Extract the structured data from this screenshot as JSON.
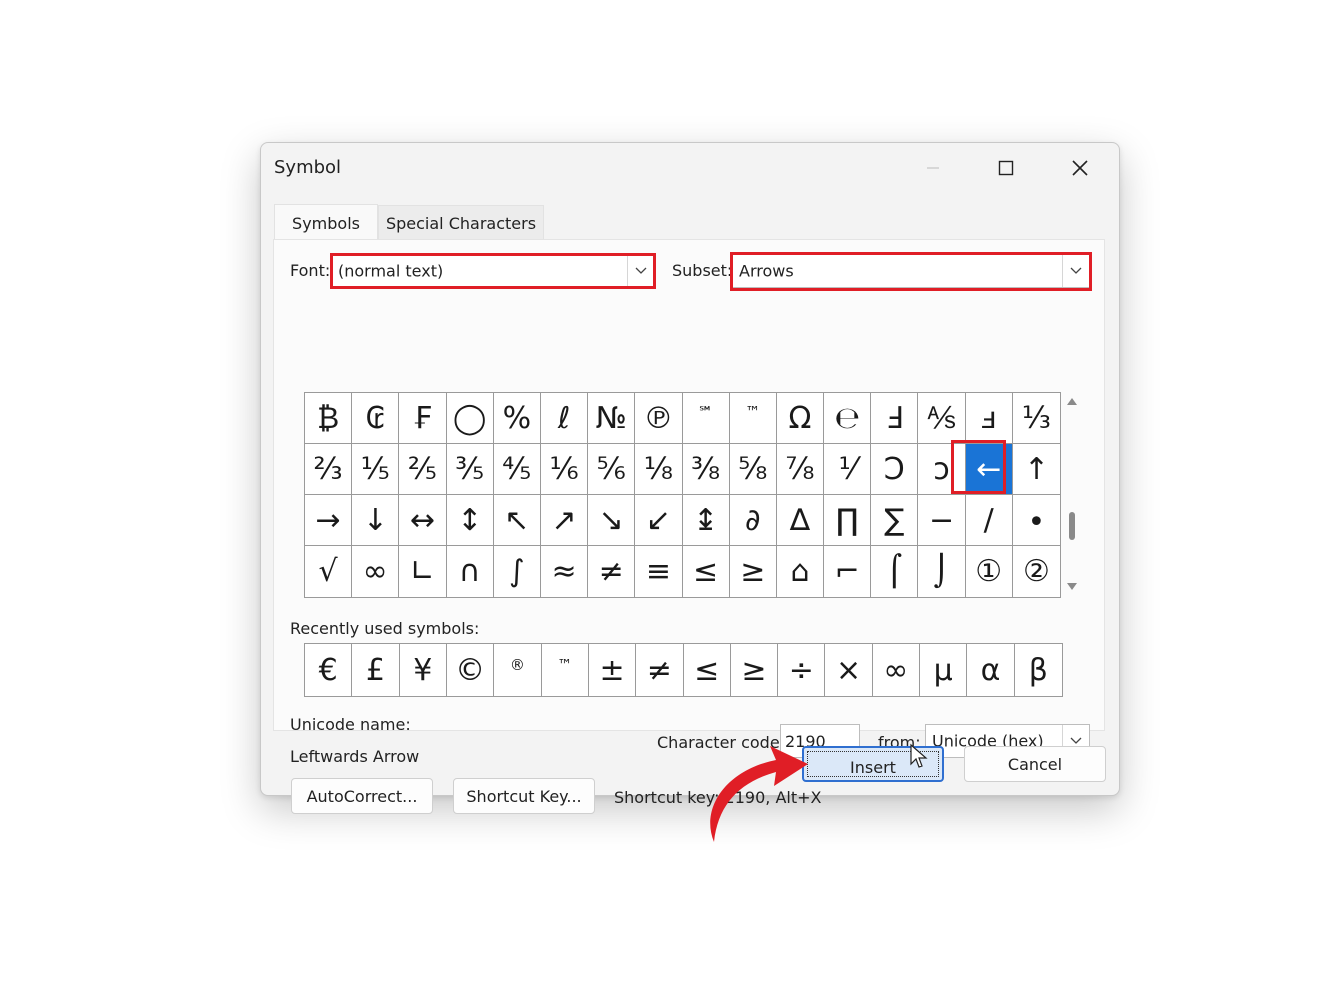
{
  "window": {
    "title": "Symbol"
  },
  "tabs": [
    {
      "label": "Symbols"
    },
    {
      "label": "Special Characters"
    }
  ],
  "font": {
    "label": "Font:",
    "value": "(normal text)"
  },
  "subset": {
    "label": "Subset:",
    "value": "Arrows"
  },
  "symbols": [
    [
      "₿",
      "₢",
      "₣",
      "◯",
      "%",
      "ℓ",
      "№",
      "℗",
      "℠",
      "™",
      "Ω",
      "℮",
      "Ⅎ",
      "⅍",
      "ⅎ",
      "⅓"
    ],
    [
      "⅔",
      "⅕",
      "⅖",
      "⅗",
      "⅘",
      "⅙",
      "⅚",
      "⅛",
      "⅜",
      "⅝",
      "⅞",
      "⅟",
      "Ↄ",
      "ↄ",
      "←",
      "↑"
    ],
    [
      "→",
      "↓",
      "↔",
      "↕",
      "↖",
      "↗",
      "↘",
      "↙",
      "↨",
      "∂",
      "∆",
      "∏",
      "∑",
      "−",
      "∕",
      "∙"
    ],
    [
      "√",
      "∞",
      "∟",
      "∩",
      "∫",
      "≈",
      "≠",
      "≡",
      "≤",
      "≥",
      "⌂",
      "⌐",
      "⌠",
      "⌡",
      "①",
      "②"
    ]
  ],
  "selected_symbol": "←",
  "recently_used": {
    "label": "Recently used symbols:",
    "items": [
      "€",
      "£",
      "¥",
      "©",
      "®",
      "™",
      "±",
      "≠",
      "≤",
      "≥",
      "÷",
      "×",
      "∞",
      "µ",
      "α",
      "β"
    ]
  },
  "unicode_name": {
    "label": "Unicode name:",
    "value": "Leftwards Arrow"
  },
  "character_code": {
    "label": "Character code:",
    "value": "2190"
  },
  "from": {
    "label": "from:",
    "value": "Unicode (hex)"
  },
  "buttons": {
    "autocorrect": "AutoCorrect...",
    "shortcut_key": "Shortcut Key...",
    "insert": "Insert",
    "cancel": "Cancel"
  },
  "shortcut_key_text": "Shortcut key: 2190, Alt+X",
  "colors": {
    "highlight_red": "#e01e26",
    "selection_blue": "#1a74d6",
    "insert_border": "#2f6fd0"
  },
  "icons": [
    "minimize-icon",
    "maximize-icon",
    "close-icon",
    "chevron-down-icon",
    "mouse-pointer-icon",
    "red-curved-arrow-icon"
  ]
}
